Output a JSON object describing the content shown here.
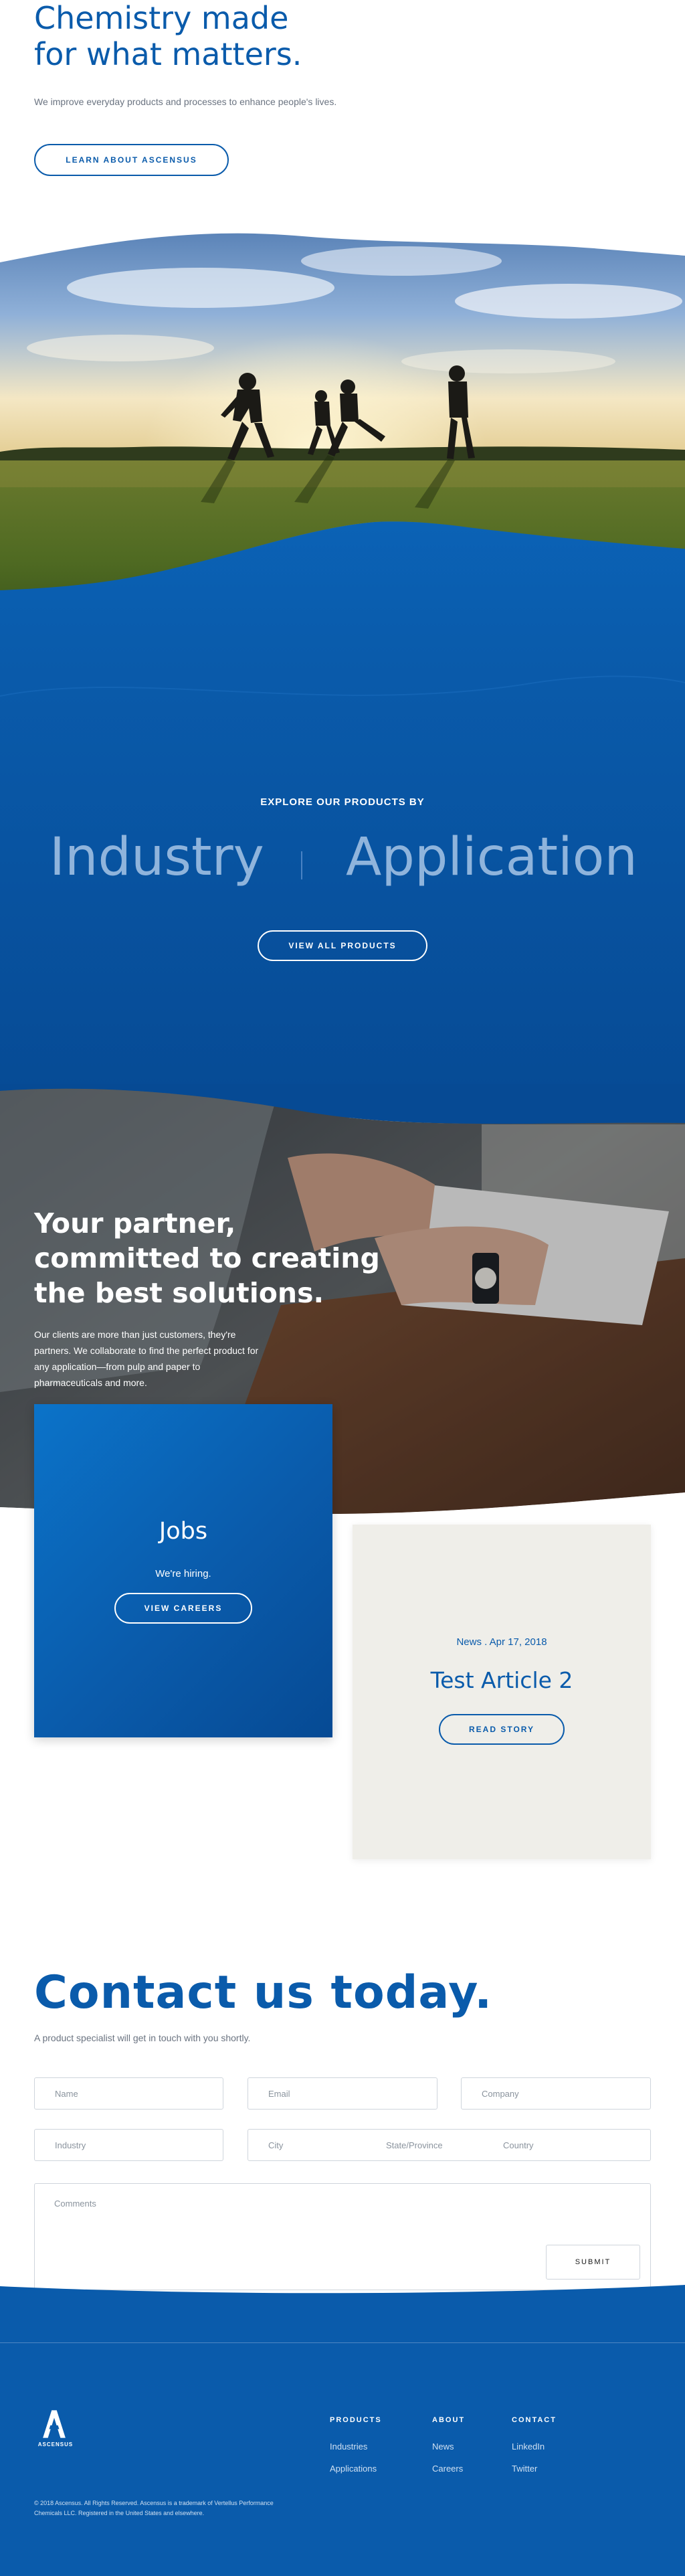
{
  "hero": {
    "title_line1": "Chemistry made",
    "title_line2": "for what matters.",
    "subtitle": "We improve everyday products and processes to enhance people's lives.",
    "cta_label": "LEARN ABOUT ASCENSUS"
  },
  "products": {
    "explore_label": "EXPLORE OUR PRODUCTS BY",
    "industry_label": "Industry",
    "application_label": "Application",
    "view_all_label": "VIEW ALL PRODUCTS"
  },
  "partner": {
    "title_line1": "Your partner,",
    "title_line2": "committed to creating",
    "title_line3": "the best solutions.",
    "body": "Our clients are more than just customers, they're partners. We collaborate to find the perfect product for any application—from pulp and paper to pharmaceuticals and more."
  },
  "jobs_card": {
    "title": "Jobs",
    "subtitle": "We're hiring.",
    "cta_label": "VIEW CAREERS"
  },
  "article_card": {
    "meta": "News . Apr 17, 2018",
    "title": "Test Article 2",
    "cta_label": "READ STORY"
  },
  "contact": {
    "title": "Contact us today.",
    "subtitle": "A product specialist will get in touch with you shortly.",
    "placeholders": {
      "name": "Name",
      "email": "Email",
      "company": "Company",
      "industry": "Industry",
      "city": "City",
      "state": "State/Province",
      "country": "Country",
      "comments": "Comments"
    },
    "submit_label": "SUBMIT"
  },
  "footer": {
    "logo_text": "ASCENSUS",
    "columns": [
      {
        "heading": "PRODUCTS",
        "links": [
          "Industries",
          "Applications"
        ]
      },
      {
        "heading": "ABOUT",
        "links": [
          "News",
          "Careers"
        ]
      },
      {
        "heading": "CONTACT",
        "links": [
          "LinkedIn",
          "Twitter"
        ]
      }
    ],
    "copyright": "© 2018 Ascensus. All Rights Reserved. Ascensus is a trademark of Vertellus Performance Chemicals LLC. Registered in the United States and elsewhere."
  },
  "colors": {
    "brand_blue": "#0a5bab",
    "deep_blue": "#064a94",
    "light_blue_text": "#8fb4dc",
    "card_beige": "#efeee9"
  },
  "icons": {
    "logo": "ascensus-a-logo"
  }
}
